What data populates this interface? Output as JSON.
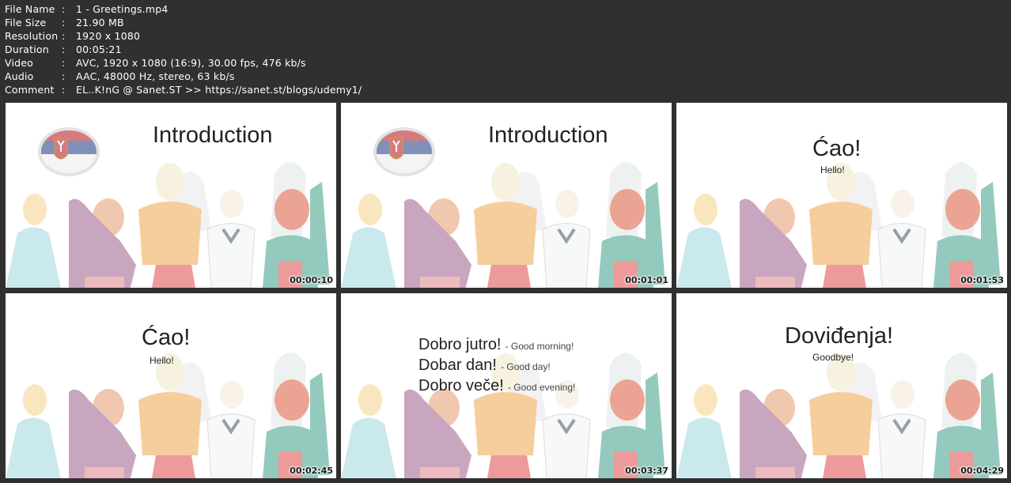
{
  "info": {
    "rows": [
      {
        "label": "File Name",
        "value": "1 - Greetings.mp4"
      },
      {
        "label": "File Size",
        "value": "21.90 MB"
      },
      {
        "label": "Resolution",
        "value": "1920 x 1080"
      },
      {
        "label": "Duration",
        "value": "00:05:21"
      },
      {
        "label": "Video",
        "value": "AVC, 1920 x 1080 (16:9), 30.00 fps, 476 kb/s"
      },
      {
        "label": "Audio",
        "value": "AAC, 48000 Hz, stereo, 63 kb/s"
      },
      {
        "label": "Comment",
        "value": "EL..K!nG @ Sanet.ST >> https://sanet.st/blogs/udemy1/"
      }
    ],
    "separator": ":"
  },
  "thumbs": [
    {
      "timestamp": "00:00:10",
      "title": "Introduction",
      "flag": true
    },
    {
      "timestamp": "00:01:01",
      "title": "Introduction",
      "flag": true
    },
    {
      "timestamp": "00:01:53",
      "title": "Ćao!",
      "subtitle": "Hello!"
    },
    {
      "timestamp": "00:02:45",
      "title": "Ćao!",
      "subtitle": "Hello!"
    },
    {
      "timestamp": "00:03:37",
      "phrases": [
        {
          "sr": "Dobro jutro!",
          "en": "- Good morning!"
        },
        {
          "sr": "Dobar dan!",
          "en": "- Good day!"
        },
        {
          "sr": "Dobro veče!",
          "en": "- Good evening!"
        }
      ]
    },
    {
      "timestamp": "00:04:29",
      "title": "Doviđenja!",
      "subtitle": "Goodbye!"
    }
  ]
}
